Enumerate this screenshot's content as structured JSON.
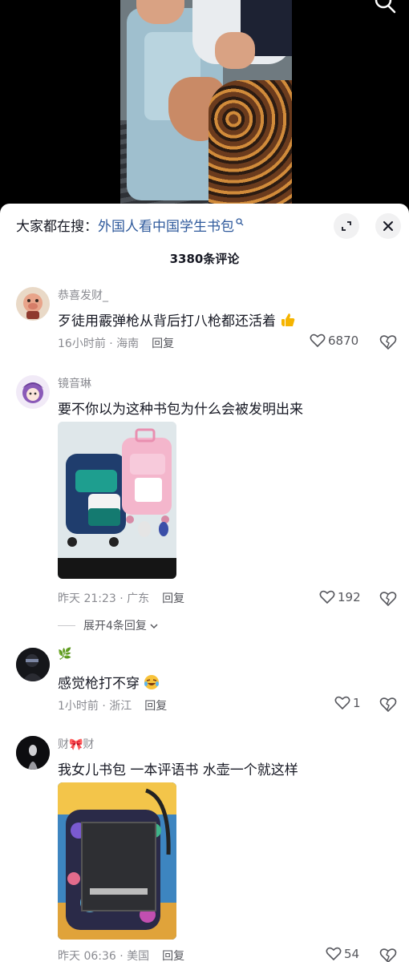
{
  "search": {
    "prefix": "大家都在搜：",
    "query": "外国人看中国学生书包"
  },
  "comment_count": "3380条评论",
  "comments": [
    {
      "username": "恭喜发财_",
      "text": "歹徒用霰弹枪从背后打八枪都还活着",
      "meta": "16小时前 · 海南",
      "reply_label": "回复",
      "likes": "6870",
      "emoji": "thumbs-up"
    },
    {
      "username": "镜音琳",
      "text": "要不你以为这种书包为什么会被发明出来",
      "meta": "昨天 21:23 · 广东",
      "reply_label": "回复",
      "likes": "192",
      "expand_label": "展开4条回复"
    },
    {
      "username": "🌿",
      "text": "感觉枪打不穿",
      "meta": "1小时前 · 浙江",
      "reply_label": "回复",
      "likes": "1",
      "emoji": "crying-laughing"
    },
    {
      "username": "财🎀财",
      "text": "我女儿书包 一本评语书 水壶一个就这样",
      "meta": "昨天 06:36 · 美国",
      "reply_label": "回复",
      "likes": "54"
    }
  ],
  "colors": {
    "link": "#2f5a9c",
    "secondary_text": "#8a8b91",
    "primary_text": "#161823"
  }
}
